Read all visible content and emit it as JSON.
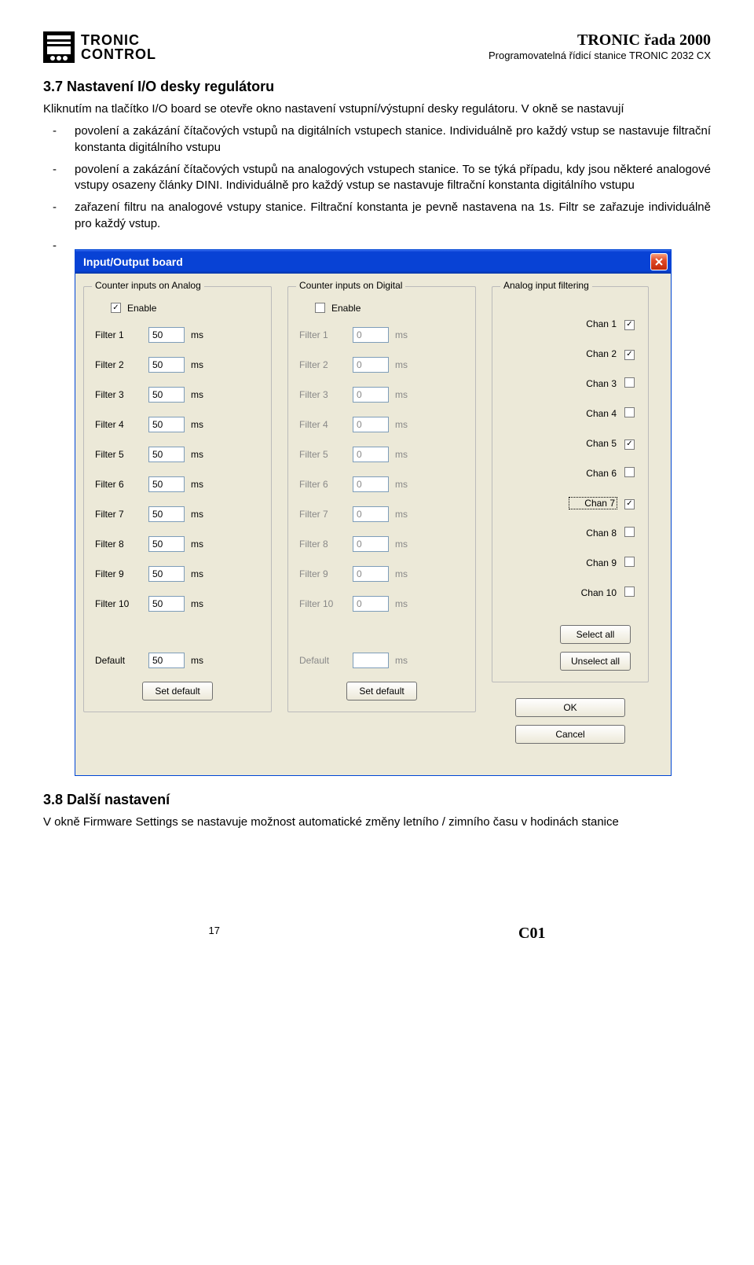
{
  "header": {
    "logo_line1": "TRONIC",
    "logo_line2": "CONTROL",
    "series": "TRONIC řada 2000",
    "subtitle": "Programovatelná řídicí stanice TRONIC 2032 CX"
  },
  "section37": {
    "title": "3.7 Nastavení I/O desky regulátoru",
    "intro": "Kliknutím na tlačítko I/O board se otevře okno nastavení vstupní/výstupní desky regulátoru. V okně se nastavují",
    "bullets": [
      "povolení a zakázání čítačových vstupů na digitálních vstupech stanice. Individuálně pro každý vstup se nastavuje filtrační konstanta digitálního vstupu",
      "povolení a zakázání čítačových vstupů na analogových vstupech stanice. To se týká případu, kdy jsou některé analogové vstupy osazeny články DINI. Individuálně pro každý vstup se nastavuje filtrační konstanta digitálního vstupu",
      "zařazení filtru na analogové vstupy stanice. Filtrační konstanta je pevně nastavena na 1s. Filtr se zařazuje individuálně pro každý vstup."
    ]
  },
  "dialog": {
    "title": "Input/Output board",
    "close": "X",
    "ms": "ms",
    "group_analog": {
      "legend": "Counter inputs on Analog",
      "enable_label": "Enable",
      "enable_checked": true,
      "filters": [
        {
          "label": "Filter 1",
          "value": "50"
        },
        {
          "label": "Filter 2",
          "value": "50"
        },
        {
          "label": "Filter 3",
          "value": "50"
        },
        {
          "label": "Filter 4",
          "value": "50"
        },
        {
          "label": "Filter 5",
          "value": "50"
        },
        {
          "label": "Filter 6",
          "value": "50"
        },
        {
          "label": "Filter 7",
          "value": "50"
        },
        {
          "label": "Filter 8",
          "value": "50"
        },
        {
          "label": "Filter 9",
          "value": "50"
        },
        {
          "label": "Filter 10",
          "value": "50"
        }
      ],
      "default_label": "Default",
      "default_value": "50",
      "set_default": "Set default"
    },
    "group_digital": {
      "legend": "Counter inputs on Digital",
      "enable_label": "Enable",
      "enable_checked": false,
      "filters": [
        {
          "label": "Filter 1",
          "value": "0"
        },
        {
          "label": "Filter 2",
          "value": "0"
        },
        {
          "label": "Filter 3",
          "value": "0"
        },
        {
          "label": "Filter 4",
          "value": "0"
        },
        {
          "label": "Filter 5",
          "value": "0"
        },
        {
          "label": "Filter 6",
          "value": "0"
        },
        {
          "label": "Filter 7",
          "value": "0"
        },
        {
          "label": "Filter 8",
          "value": "0"
        },
        {
          "label": "Filter 9",
          "value": "0"
        },
        {
          "label": "Filter 10",
          "value": "0"
        }
      ],
      "default_label": "Default",
      "default_value": "",
      "set_default": "Set default"
    },
    "group_filter": {
      "legend": "Analog input filtering",
      "channels": [
        {
          "label": "Chan 1",
          "checked": true
        },
        {
          "label": "Chan 2",
          "checked": true
        },
        {
          "label": "Chan 3",
          "checked": false
        },
        {
          "label": "Chan 4",
          "checked": false
        },
        {
          "label": "Chan 5",
          "checked": true
        },
        {
          "label": "Chan 6",
          "checked": false
        },
        {
          "label": "Chan 7",
          "checked": true
        },
        {
          "label": "Chan 8",
          "checked": false
        },
        {
          "label": "Chan 9",
          "checked": false
        },
        {
          "label": "Chan 10",
          "checked": false
        }
      ],
      "select_all": "Select all",
      "unselect_all": "Unselect all"
    },
    "ok": "OK",
    "cancel": "Cancel"
  },
  "section38": {
    "title": "3.8 Další nastavení",
    "body": "V okně Firmware Settings se nastavuje možnost automatické změny letního / zimního času v hodinách stanice"
  },
  "footer": {
    "page": "17",
    "code": "C01"
  }
}
